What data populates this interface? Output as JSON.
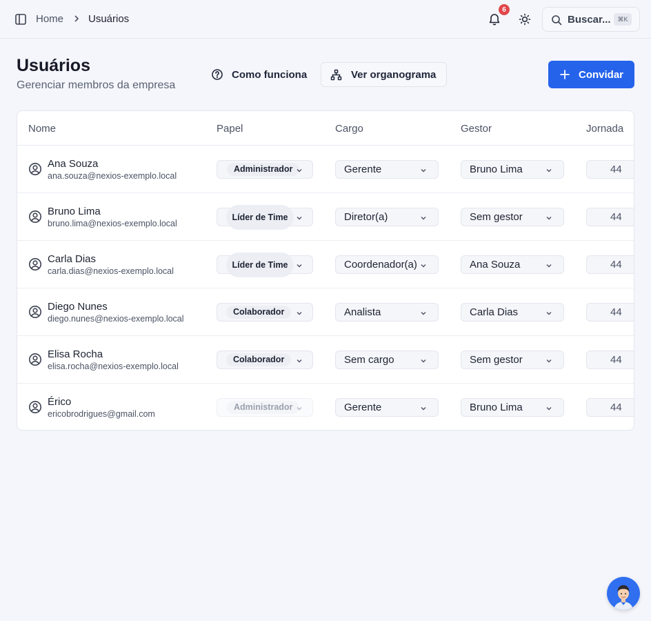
{
  "breadcrumb": {
    "home": "Home",
    "current": "Usuários"
  },
  "header": {
    "notifications_count": "6",
    "search_placeholder": "Buscar...",
    "search_shortcut": "⌘K"
  },
  "page": {
    "title": "Usuários",
    "subtitle": "Gerenciar membros da empresa",
    "how_it_works": "Como funciona",
    "org_chart": "Ver organograma",
    "invite": "Convidar"
  },
  "table": {
    "columns": [
      "Nome",
      "Papel",
      "Cargo",
      "Gestor",
      "Jornada"
    ],
    "rows": [
      {
        "name": "Ana Souza",
        "email": "ana.souza@nexios-exemplo.local",
        "role": "Administrador",
        "position": "Gerente",
        "manager": "Bruno Lima",
        "hours": "44"
      },
      {
        "name": "Bruno Lima",
        "email": "bruno.lima@nexios-exemplo.local",
        "role": "Líder de Time",
        "position": "Diretor(a)",
        "manager": "Sem gestor",
        "hours": "44"
      },
      {
        "name": "Carla Dias",
        "email": "carla.dias@nexios-exemplo.local",
        "role": "Líder de Time",
        "position": "Coordenador(a)",
        "manager": "Ana Souza",
        "hours": "44"
      },
      {
        "name": "Diego Nunes",
        "email": "diego.nunes@nexios-exemplo.local",
        "role": "Colaborador",
        "position": "Analista",
        "manager": "Carla Dias",
        "hours": "44"
      },
      {
        "name": "Elisa Rocha",
        "email": "elisa.rocha@nexios-exemplo.local",
        "role": "Colaborador",
        "position": "Sem cargo",
        "manager": "Sem gestor",
        "hours": "44"
      },
      {
        "name": "Érico",
        "email": "ericobrodrigues@gmail.com",
        "role": "Administrador",
        "position": "Gerente",
        "manager": "Bruno Lima",
        "hours": "44"
      }
    ]
  },
  "icons": {
    "sidebar_toggle": "sidebar-panel-icon",
    "breadcrumb_separator": "chevron-right-icon",
    "notifications": "bell-icon",
    "theme": "sun-icon",
    "search": "search-icon",
    "help": "question-circle-icon",
    "org_chart": "org-chart-icon",
    "invite": "plus-icon",
    "user": "user-circle-icon",
    "dropdown": "chevron-down-icon"
  },
  "colors": {
    "primary": "#2563eb",
    "badge": "#e0474c",
    "background": "#f5f6fb"
  }
}
